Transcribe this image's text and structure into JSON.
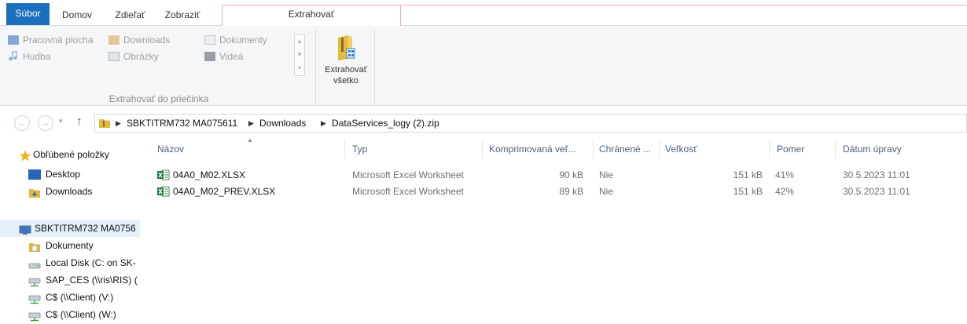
{
  "ribbon": {
    "tabs": {
      "file": "Súbor",
      "home": "Domov",
      "share": "Zdieľať",
      "view": "Zobraziť",
      "extract": "Extrahovať"
    },
    "locations": {
      "desktop": "Pracovná plocha",
      "downloads": "Downloads",
      "documents": "Dokumenty",
      "music": "Hudba",
      "pictures": "Obrázky",
      "videos": "Videá"
    },
    "group_label": "Extrahovať do priečinka",
    "extract_all_line1": "Extrahovať",
    "extract_all_line2": "všetko",
    "accent": "#1c6fbd",
    "tool_tab_accent": "#f0a8c8"
  },
  "address": {
    "crumbs": [
      "SBKTITRM732 MA075611",
      "Downloads",
      "DataServices_logy (2).zip"
    ]
  },
  "nav_pane": {
    "favorites": "Obľúbené položky",
    "desktop": "Desktop",
    "downloads": "Downloads",
    "computer": "SBKTITRM732 MA0756",
    "documents": "Dokumenty",
    "local_disk": "Local Disk (C: on SK-",
    "sap": "SAP_CES (\\\\ris\\RIS) (",
    "client_v": "C$ (\\\\Client) (V:)",
    "client_w": "C$ (\\\\Client) (W:)"
  },
  "columns": {
    "name": "Názov",
    "type": "Typ",
    "compressed": "Komprimovaná veľ...",
    "protected": "Chránené ...",
    "size": "Veľkosť",
    "ratio": "Pomer",
    "modified": "Dátum úpravy"
  },
  "files": [
    {
      "name": "04A0_M02.XLSX",
      "type": "Microsoft Excel Worksheet",
      "compressed": "90 kB",
      "protected": "Nie",
      "size": "151 kB",
      "ratio": "41%",
      "modified": "30.5.2023 11:01"
    },
    {
      "name": "04A0_M02_PREV.XLSX",
      "type": "Microsoft Excel Worksheet",
      "compressed": "89 kB",
      "protected": "Nie",
      "size": "151 kB",
      "ratio": "42%",
      "modified": "30.5.2023 11:01"
    }
  ]
}
